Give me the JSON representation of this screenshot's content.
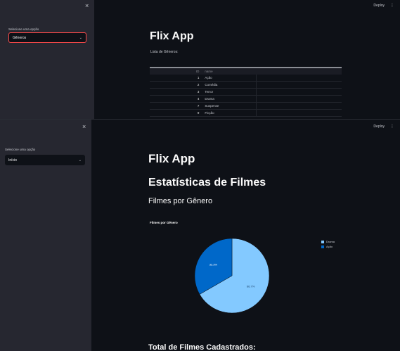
{
  "panel1": {
    "sidebar": {
      "close_icon": "×",
      "select_label": "Selecione uma opção",
      "selected": "Gêneros"
    },
    "topbar": {
      "deploy": "Deploy",
      "menu_icon": "⋮"
    },
    "app_title": "Flix App",
    "subtitle": "Lista de Gêneros:",
    "table": {
      "columns": [
        "ID",
        "name"
      ],
      "rows": [
        {
          "id": "1",
          "name": "Ação"
        },
        {
          "id": "2",
          "name": "Comédia"
        },
        {
          "id": "3",
          "name": "Terror"
        },
        {
          "id": "4",
          "name": "Drama"
        },
        {
          "id": "7",
          "name": "Suspense"
        },
        {
          "id": "9",
          "name": "Ficção"
        }
      ]
    }
  },
  "panel2": {
    "sidebar": {
      "close_icon": "×",
      "select_label": "Selecione uma opção",
      "selected": "Início"
    },
    "topbar": {
      "deploy": "Deploy",
      "menu_icon": "⋮"
    },
    "app_title": "Flix App",
    "heading": "Estatísticas de Filmes",
    "subheading": "Filmes por Gênero",
    "footer_heading": "Total de Filmes Cadastrados:"
  },
  "chart_data": {
    "type": "pie",
    "title": "Filmes por Gênero",
    "slices": [
      {
        "name": "Drama",
        "value": 66.7,
        "label": "66.7%",
        "color": "#83c9ff"
      },
      {
        "name": "Ação",
        "value": 33.3,
        "label": "33.3%",
        "color": "#0068c9"
      }
    ],
    "legend_placement": "top-right"
  },
  "colors": {
    "background": "#0e1117",
    "sidebar": "#262730",
    "text": "#fafafa"
  }
}
